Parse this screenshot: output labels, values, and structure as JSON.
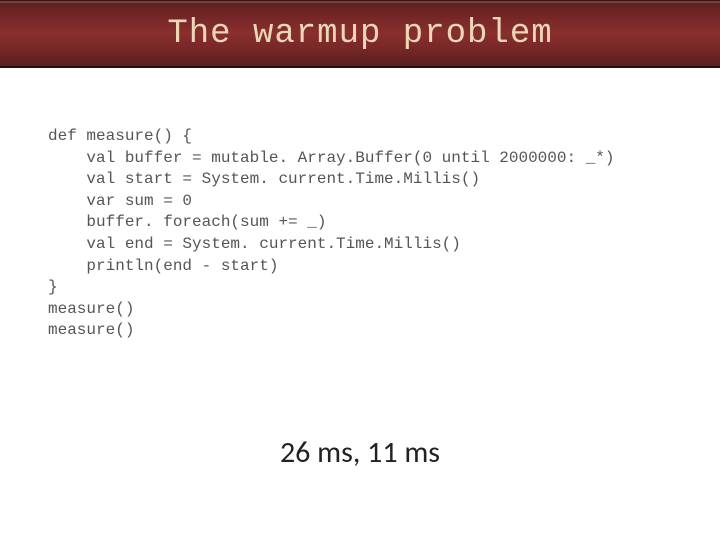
{
  "title": "The warmup problem",
  "code": "def measure() {\n    val buffer = mutable. Array.Buffer(0 until 2000000: _*)\n    val start = System. current.Time.Millis()\n    var sum = 0\n    buffer. foreach(sum += _)\n    val end = System. current.Time.Millis()\n    println(end - start)\n}\nmeasure()\nmeasure()",
  "result": "26 ms, 11 ms"
}
